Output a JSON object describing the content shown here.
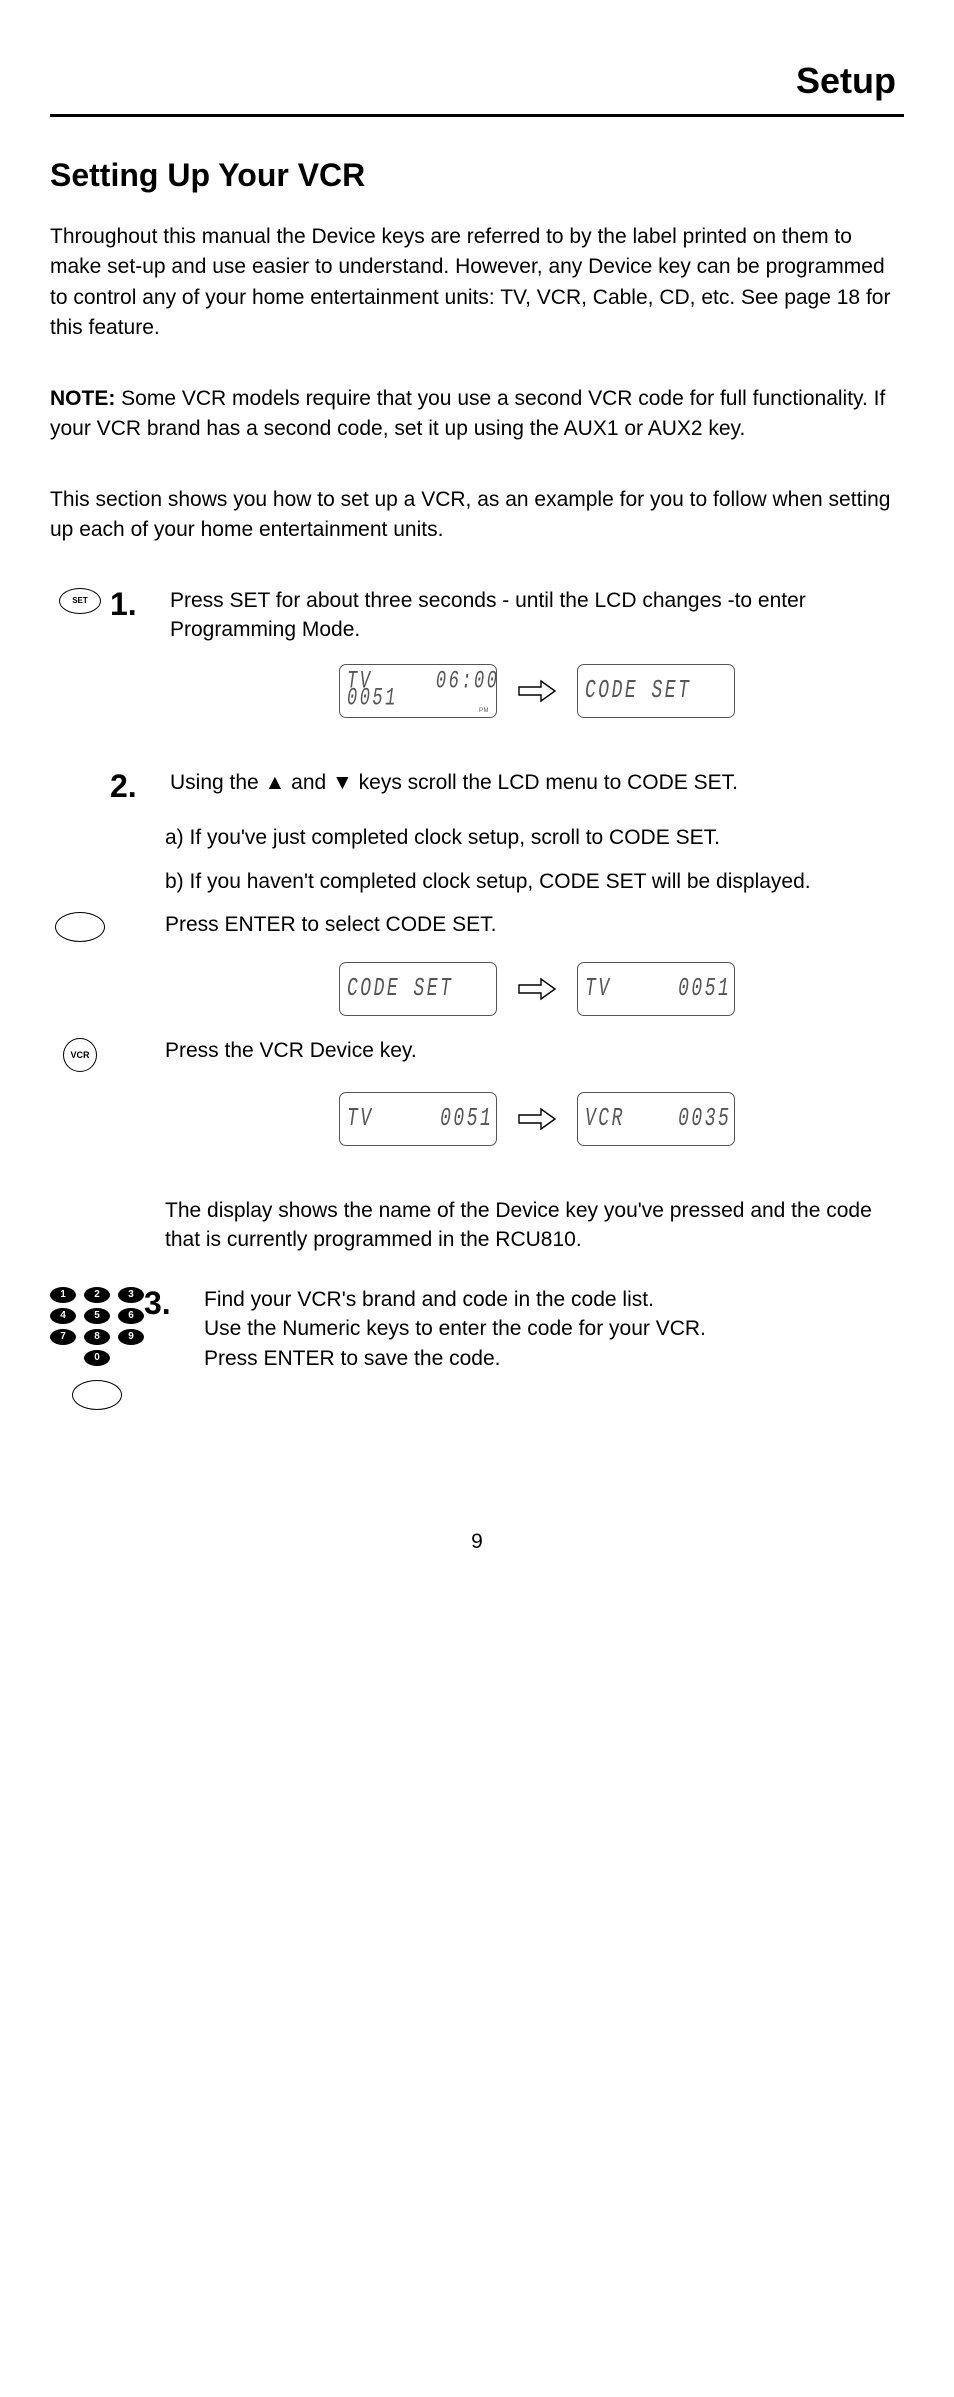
{
  "header": {
    "title": "Setup"
  },
  "section": {
    "title": "Setting Up Your VCR"
  },
  "intro": {
    "p1": "Throughout this manual the Device keys are referred to by the label printed on them to make set-up and use easier to understand. However, any Device key can be programmed to control any of your home entertainment units: TV, VCR, Cable, CD, etc. See page 18 for this feature.",
    "note_label": "NOTE:",
    "note_body": "Some VCR models require that you use a second VCR code for full functionality. If your VCR brand has a second code, set it up using the AUX1 or AUX2 key.",
    "p3": "This section shows you how to set up a VCR, as an example for you to follow when setting up each of your home entertainment units."
  },
  "step1": {
    "num": "1.",
    "text": "Press SET for about three seconds - until the LCD changes -to enter Programming Mode.",
    "lcd_left_l1": "TV     06:00",
    "lcd_left_l2": "0051",
    "lcd_left_pm": "PM",
    "lcd_right": "CODE SET"
  },
  "step2": {
    "num": "2.",
    "lead": "Using the ▲ and ▼ keys scroll the LCD menu to CODE SET.",
    "sub_a_label": "a)",
    "sub_a": "If you've just completed clock setup, scroll to CODE SET.",
    "sub_b_label": "b)",
    "sub_b": "If you haven't completed clock setup, CODE SET will be displayed.",
    "btn_text_1": "Press ENTER  to select  CODE SET.",
    "lcd2_left": "CODE SET",
    "lcd2_right": "TV     0051",
    "btn_text_2": "Press the VCR Device key.",
    "lcd3_left": "TV     0051",
    "lcd3_right": "VCR    0035",
    "tail": "The display shows the name of the Device key you've pressed and the code that is currently programmed in the RCU810."
  },
  "step3": {
    "num": "3.",
    "line1": "Find your VCR's brand and code in the code list.",
    "line2": "Use the Numeric keys to enter the code for your VCR.",
    "line3": "Press ENTER to save the code."
  },
  "buttons": {
    "set": "SET",
    "vcr": "VCR"
  },
  "keypad": [
    "1",
    "2",
    "3",
    "4",
    "5",
    "6",
    "7",
    "8",
    "9",
    "0"
  ],
  "page": "9"
}
